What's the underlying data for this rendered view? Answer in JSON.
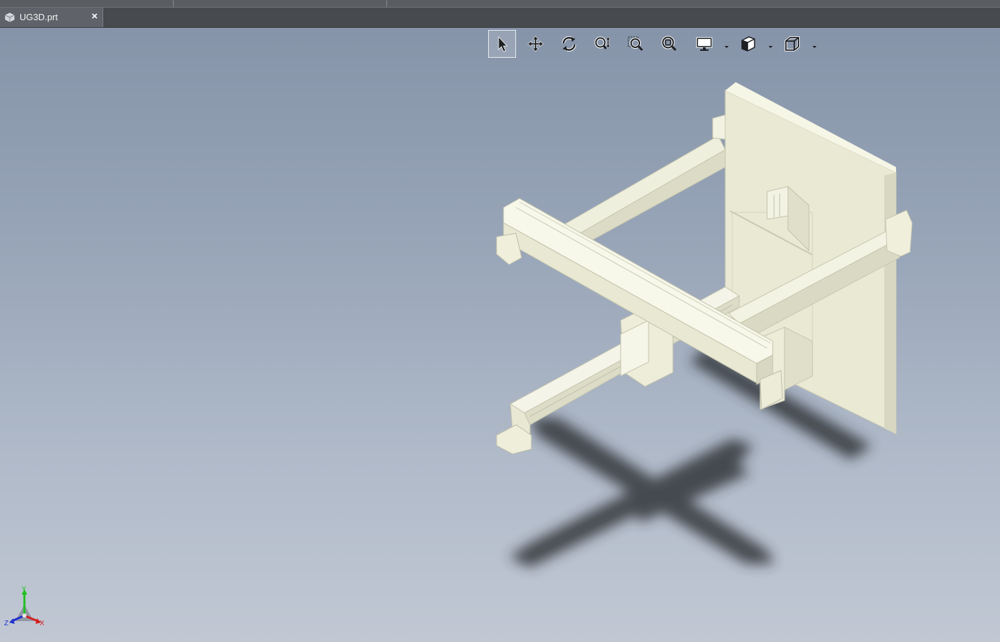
{
  "window": {
    "tab": {
      "label": "UG3D.prt",
      "icon": "part-file-icon",
      "close_label": "×"
    }
  },
  "viewport": {
    "background_top": "#8694a9",
    "background_bottom": "#c1c8d4",
    "model_color": "#eeeed8",
    "toolbar": {
      "tools": [
        {
          "name": "select-tool",
          "icon": "arrow-cursor-icon",
          "active": true
        },
        {
          "name": "pan-tool",
          "icon": "move-arrows-icon",
          "active": false
        },
        {
          "name": "rotate-tool",
          "icon": "rotate-icon",
          "active": false
        },
        {
          "name": "zoom-tool",
          "icon": "zoom-icon",
          "active": false
        },
        {
          "name": "zoom-window-tool",
          "icon": "zoom-window-icon",
          "active": false
        },
        {
          "name": "zoom-fit-tool",
          "icon": "zoom-fit-icon",
          "active": false
        },
        {
          "name": "display-style-tool",
          "icon": "monitor-icon",
          "active": false,
          "dropdown": true
        },
        {
          "name": "section-view-tool",
          "icon": "section-icon",
          "active": false,
          "dropdown": true
        },
        {
          "name": "view-orientation-tool",
          "icon": "cube-view-icon",
          "active": false,
          "dropdown": true
        }
      ]
    },
    "triad": {
      "x_label": "X",
      "y_label": "Y",
      "z_label": "Z",
      "x_color": "#d42020",
      "y_color": "#20c020",
      "z_color": "#2030d0"
    }
  }
}
